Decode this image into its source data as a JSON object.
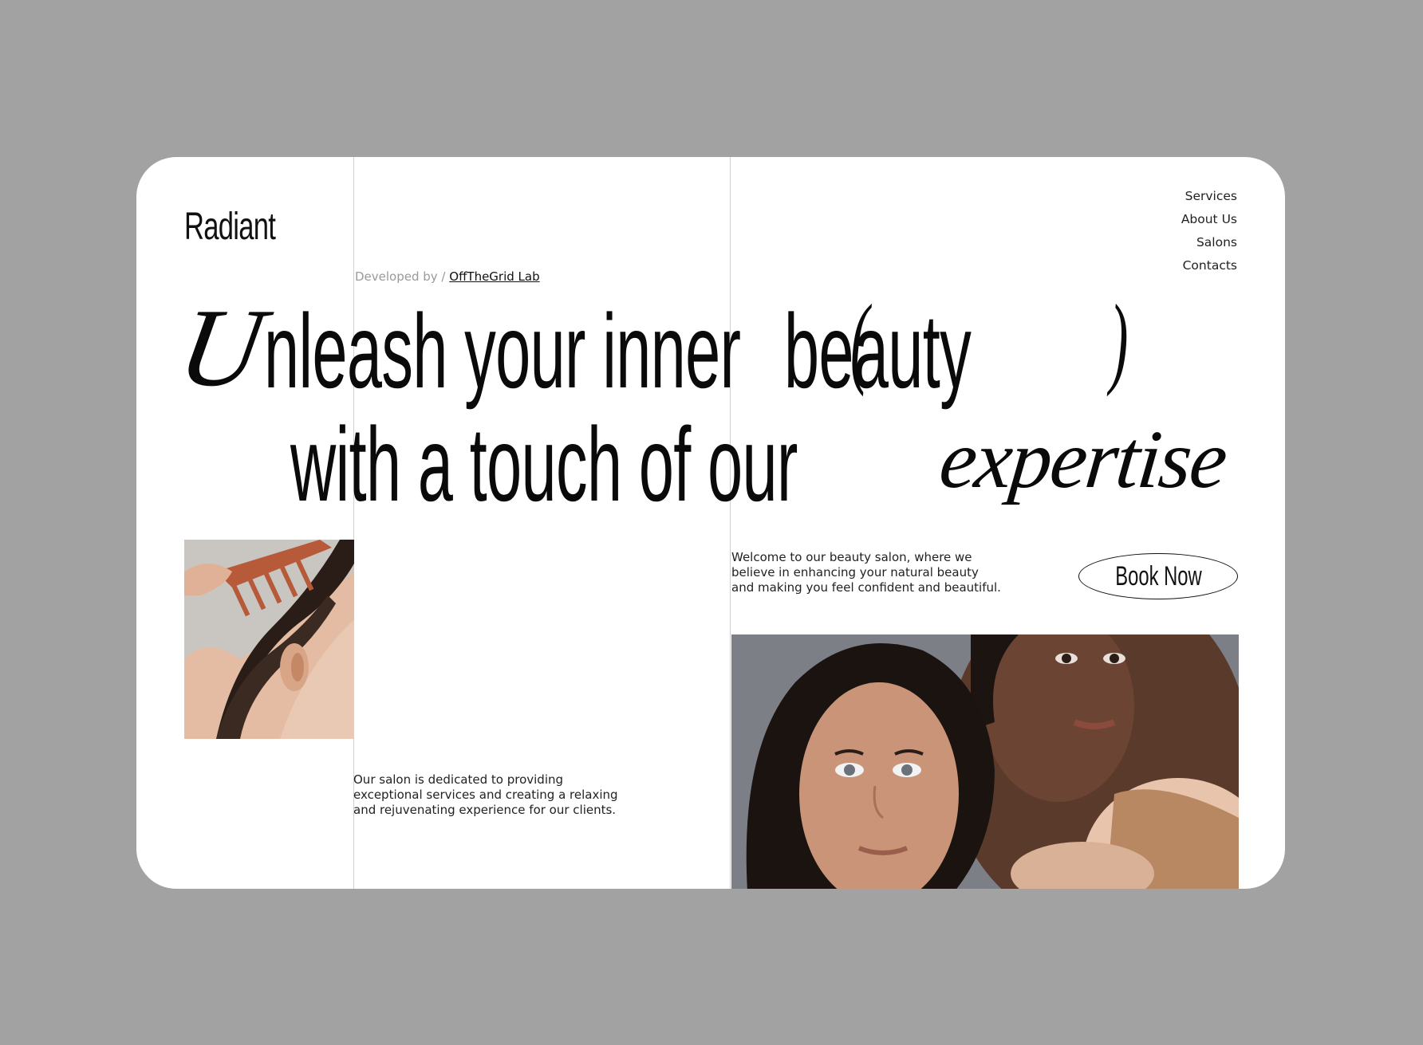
{
  "brand": {
    "name": "Radiant"
  },
  "credit": {
    "prefix": "Developed by / ",
    "link_text": "OffTheGrid Lab"
  },
  "nav": {
    "items": [
      "Services",
      "About Us",
      "Salons",
      "Contacts"
    ]
  },
  "hero": {
    "line1_script_initial": "U",
    "line1_text": "nleash your inner",
    "line1_paren_open": "(",
    "line1_word": "beauty",
    "line1_paren_close": ")",
    "line2_text": "with a touch of our",
    "line2_script": "expertise"
  },
  "welcome": {
    "line1": "Welcome to our beauty salon, where we",
    "line2": "believe in enhancing your natural beauty",
    "line3": "and making you feel confident and beautiful."
  },
  "cta": {
    "book_label": "Book Now"
  },
  "about": {
    "line1": "Our salon is dedicated to providing",
    "line2": "exceptional services and creating a relaxing",
    "line3": "and rejuvenating experience for our clients."
  },
  "colors": {
    "background": "#a2a2a2",
    "card": "#ffffff",
    "text": "#0a0a0a",
    "divider": "#d0d0d0"
  }
}
